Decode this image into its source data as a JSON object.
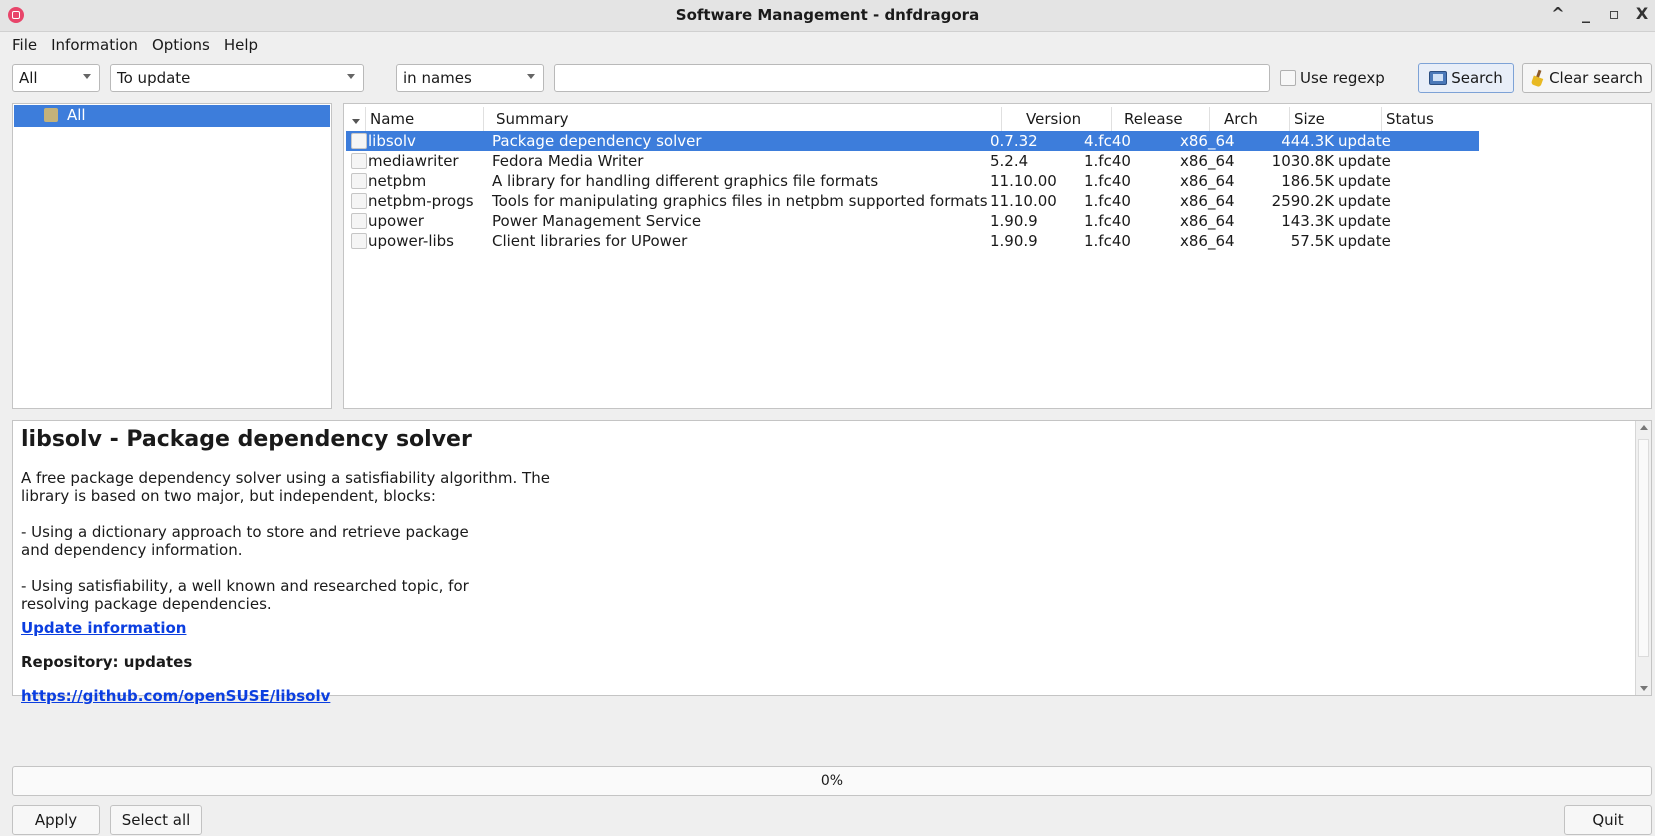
{
  "window": {
    "title": "Software Management - dnfdragora",
    "controls": [
      "^",
      "_",
      "▫",
      "X"
    ]
  },
  "menu": [
    "File",
    "Information",
    "Options",
    "Help"
  ],
  "filters": {
    "view": "All",
    "type": "To update",
    "scope": "in names",
    "search_value": "",
    "regex_label": "Use regexp",
    "search_button": "Search",
    "clear_button": "Clear search"
  },
  "groups": [
    {
      "label": "All",
      "selected": true
    }
  ],
  "table": {
    "columns": [
      "Name",
      "Summary",
      "Version",
      "Release",
      "Arch",
      "Size",
      "Status"
    ],
    "rows": [
      {
        "name": "libsolv",
        "summary": "Package dependency solver",
        "version": "0.7.32",
        "release": "4.fc40",
        "arch": "x86_64",
        "size": "444.3K",
        "status": "update",
        "selected": true
      },
      {
        "name": "mediawriter",
        "summary": "Fedora Media Writer",
        "version": "5.2.4",
        "release": "1.fc40",
        "arch": "x86_64",
        "size": "1030.8K",
        "status": "update",
        "selected": false
      },
      {
        "name": "netpbm",
        "summary": "A library for handling different graphics file formats",
        "version": "11.10.00",
        "release": "1.fc40",
        "arch": "x86_64",
        "size": "186.5K",
        "status": "update",
        "selected": false
      },
      {
        "name": "netpbm-progs",
        "summary": "Tools for manipulating graphics files in netpbm supported formats",
        "version": "11.10.00",
        "release": "1.fc40",
        "arch": "x86_64",
        "size": "2590.2K",
        "status": "update",
        "selected": false
      },
      {
        "name": "upower",
        "summary": "Power Management Service",
        "version": "1.90.9",
        "release": "1.fc40",
        "arch": "x86_64",
        "size": "143.3K",
        "status": "update",
        "selected": false
      },
      {
        "name": "upower-libs",
        "summary": "Client libraries for UPower",
        "version": "1.90.9",
        "release": "1.fc40",
        "arch": "x86_64",
        "size": "57.5K",
        "status": "update",
        "selected": false
      }
    ]
  },
  "info": {
    "title": "libsolv - Package dependency solver",
    "description": "A free package dependency solver using a satisfiability algorithm. The\nlibrary is based on two major, but independent, blocks:\n\n- Using a dictionary approach to store and retrieve package\nand dependency information.\n\n- Using satisfiability, a well known and researched topic, for\nresolving package dependencies.",
    "update_link": "Update information",
    "repository": "Repository: updates",
    "url": "https://github.com/openSUSE/libsolv"
  },
  "progress": {
    "value": 0,
    "label": "0%"
  },
  "buttons": {
    "apply": "Apply",
    "select_all": "Select all",
    "quit": "Quit"
  }
}
